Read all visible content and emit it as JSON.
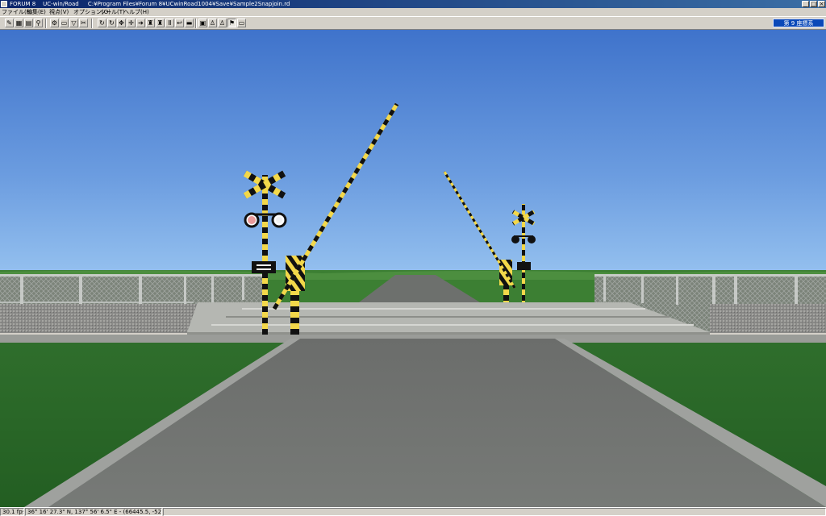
{
  "window": {
    "app_name": "FORUM 8",
    "product": "UC-win/Road",
    "file_path": "C:¥Program Files¥Forum 8¥UCwinRoad1004¥Save¥Sample2Snapjoin.rd"
  },
  "menu": [
    {
      "label": "ファイル(F)"
    },
    {
      "label": "編集(E)"
    },
    {
      "label": "視点(V)"
    },
    {
      "label": "オプション(O)"
    },
    {
      "label": "ツール(T)"
    },
    {
      "label": "ヘルプ(H)"
    }
  ],
  "toolbar": {
    "buttons": [
      {
        "icon": "pen-icon",
        "glyph": "✎"
      },
      {
        "icon": "grid-icon",
        "glyph": "▦"
      },
      {
        "icon": "table-icon",
        "glyph": "▤"
      },
      {
        "icon": "figure-icon",
        "glyph": "⚲"
      },
      {
        "icon": "settings-icon",
        "glyph": "⚙"
      },
      {
        "icon": "car-icon",
        "glyph": "▭"
      },
      {
        "icon": "signal-icon",
        "glyph": "▽"
      },
      {
        "icon": "tool-icon",
        "glyph": "✂"
      },
      {
        "icon": "rotate-icon",
        "glyph": "↻"
      },
      {
        "icon": "rotate-icon",
        "glyph": "↻"
      },
      {
        "icon": "move-icon",
        "glyph": "✥"
      },
      {
        "icon": "pan-icon",
        "glyph": "✛"
      },
      {
        "icon": "forward-icon",
        "glyph": "➔"
      },
      {
        "icon": "person-icon",
        "glyph": "♜"
      },
      {
        "icon": "person-icon",
        "glyph": "♜"
      },
      {
        "icon": "pause-icon",
        "glyph": "Ⅱ"
      },
      {
        "icon": "back-icon",
        "glyph": "↩"
      },
      {
        "icon": "minus-icon",
        "glyph": "▬"
      },
      {
        "icon": "monitor-icon",
        "glyph": "▣"
      },
      {
        "icon": "stand-icon",
        "glyph": "♙"
      },
      {
        "icon": "walk-icon",
        "glyph": "♙"
      },
      {
        "icon": "run-icon",
        "glyph": "⚑"
      },
      {
        "icon": "camera-icon",
        "glyph": "▭"
      }
    ],
    "coordinate_system": "第 9 座標系"
  },
  "status": {
    "fps": "30.1 fps",
    "position": "36° 16' 27.3\" N, 137° 56' 6.5\" E  -  (66445.5, -5223640)"
  }
}
